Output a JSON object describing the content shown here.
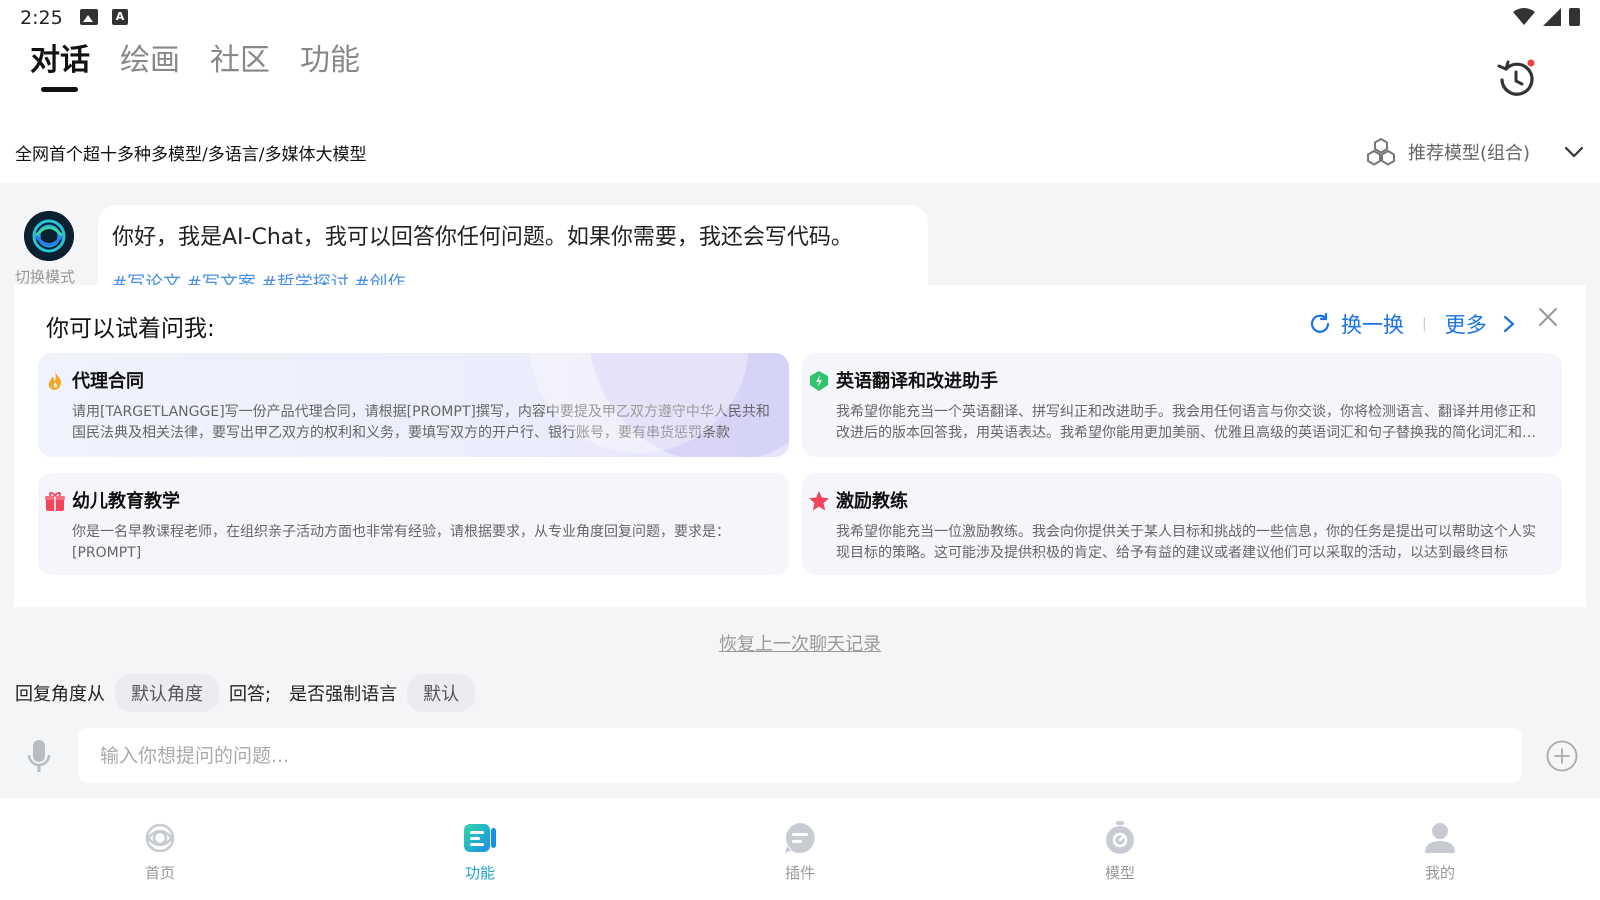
{
  "status_bar": {
    "time": "2:25"
  },
  "tabs": [
    {
      "label": "对话",
      "active": true
    },
    {
      "label": "绘画",
      "active": false
    },
    {
      "label": "社区",
      "active": false
    },
    {
      "label": "功能",
      "active": false
    }
  ],
  "subtitle": "全网首个超十多种多模型/多语言/多媒体大模型",
  "model_select": {
    "label": "推荐模型(组合)"
  },
  "chat": {
    "mode_label": "切换模式",
    "greeting": "你好，我是AI-Chat，我可以回答你任何问题。如果你需要，我还会写代码。",
    "tags": "#写论文 #写文案 #哲学探讨 #创作"
  },
  "suggestions": {
    "title": "你可以试着问我:",
    "refresh_label": "换一换",
    "more_label": "更多",
    "cards": [
      {
        "title": "代理合同",
        "icon": "flame-icon",
        "color": "#f4a62a",
        "desc": "请用[TARGETLANGGE]写一份产品代理合同，请根据[PROMPT]撰写，内容中要提及甲乙双方遵守中华人民共和国民法典及相关法律，要写出甲乙双方的权利和义务，要填写双方的开户行、银行账号，要有串货惩罚条款"
      },
      {
        "title": "英语翻译和改进助手",
        "icon": "lightning-icon",
        "color": "#2fc36b",
        "desc": "我希望你能充当一个英语翻译、拼写纠正和改进助手。我会用任何语言与你交谈，你将检测语言、翻译并用修正和改进后的版本回答我，用英语表达。我希望你能用更加美丽、优雅且高级的英语词汇和句子替换我的简化词汇和句子"
      },
      {
        "title": "幼儿教育教学",
        "icon": "gift-icon",
        "color": "#f0455a",
        "desc": "你是一名早教课程老师，在组织亲子活动方面也非常有经验，请根据要求，从专业角度回复问题，要求是：[PROMPT]"
      },
      {
        "title": "激励教练",
        "icon": "star-icon",
        "color": "#f0455a",
        "desc": "我希望你能充当一位激励教练。我会向你提供关于某人目标和挑战的一些信息，你的任务是提出可以帮助这个人实现目标的策略。这可能涉及提供积极的肯定、给予有益的建议或者建议他们可以采取的活动，以达到最终目标"
      }
    ]
  },
  "restore_link": "恢复上一次聊天记录",
  "answer_settings": {
    "prefix": "回复角度从",
    "angle": "默认角度",
    "middle": "回答;",
    "lang_prefix": "是否强制语言",
    "lang": "默认"
  },
  "input": {
    "placeholder": "输入你想提问的问题..."
  },
  "bottom_nav": [
    {
      "label": "首页",
      "icon": "home-logo-icon",
      "active": false
    },
    {
      "label": "功能",
      "icon": "function-icon",
      "active": true
    },
    {
      "label": "插件",
      "icon": "plugin-icon",
      "active": false
    },
    {
      "label": "模型",
      "icon": "model-icon",
      "active": false
    },
    {
      "label": "我的",
      "icon": "profile-icon",
      "active": false
    }
  ],
  "colors": {
    "accent": "#1a73e8",
    "nav_active": "#1ea7c9",
    "tag": "#4a90e2"
  }
}
